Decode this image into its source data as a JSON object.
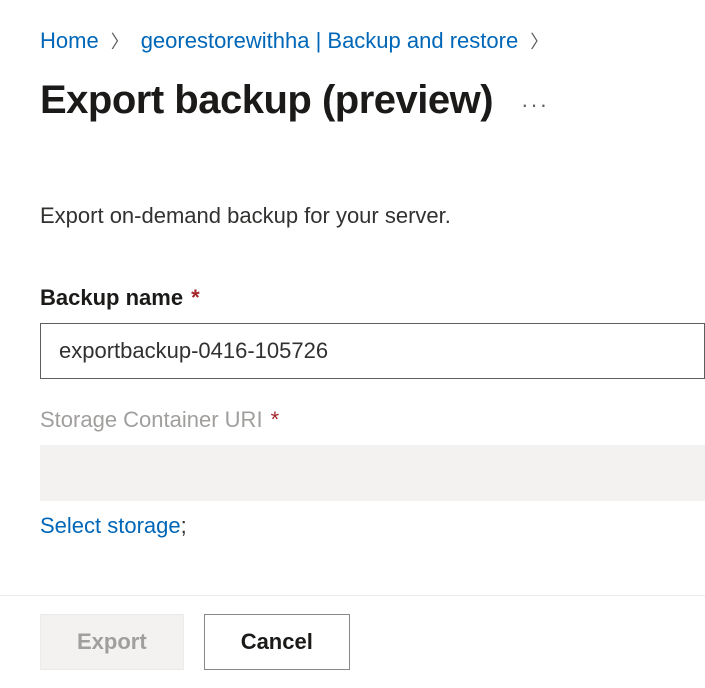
{
  "breadcrumb": {
    "home": "Home",
    "path": "georestorewithha | Backup and restore"
  },
  "title": "Export backup (preview)",
  "description": "Export on-demand backup for your server.",
  "fields": {
    "backup_name": {
      "label": "Backup name",
      "value": "exportbackup-0416-105726"
    },
    "storage_uri": {
      "label": "Storage Container URI",
      "value": ""
    }
  },
  "links": {
    "select_storage": "Select storage"
  },
  "buttons": {
    "export": "Export",
    "cancel": "Cancel"
  }
}
